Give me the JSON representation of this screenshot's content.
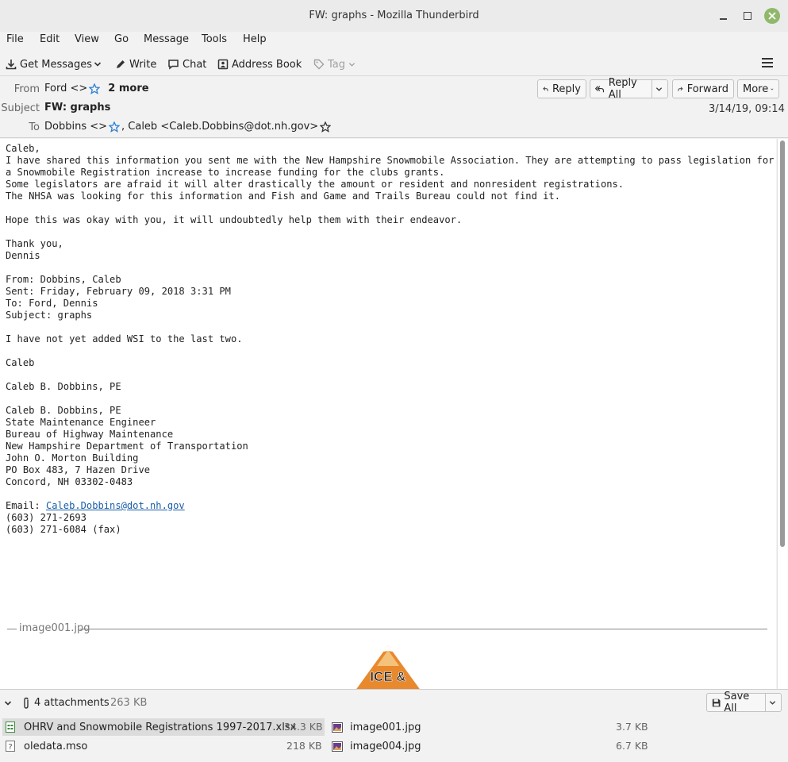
{
  "window": {
    "title": "FW: graphs - Mozilla Thunderbird"
  },
  "menu": [
    "File",
    "Edit",
    "View",
    "Go",
    "Message",
    "Tools",
    "Help"
  ],
  "toolbar": {
    "get_messages": "Get Messages",
    "write": "Write",
    "chat": "Chat",
    "address_book": "Address Book",
    "tag": "Tag"
  },
  "header": {
    "from_label": "From",
    "from_value": "Ford <>",
    "more_recipients": "2 more",
    "subject_label": "Subject",
    "subject": "FW: graphs",
    "to_label": "To",
    "to_first": "Dobbins <>",
    "to_second": ", Caleb <Caleb.Dobbins@dot.nh.gov>",
    "date": "3/14/19, 09:14",
    "buttons": {
      "reply": "Reply",
      "reply_all": "Reply All",
      "forward": "Forward",
      "more": "More"
    }
  },
  "message": {
    "lines_before_email": "Caleb,\nI have shared this information you sent me with the New Hampshire Snowmobile Association. They are attempting to pass legislation for\na Snowmobile Registration increase to increase funding for the clubs grants.\nSome legislators are afraid it will alter drastically the amount or resident and nonresident registrations.\nThe NHSA was looking for this information and Fish and Game and Trails Bureau could not find it.\n\nHope this was okay with you, it will undoubtedly help them with their endeavor.\n\nThank you,\nDennis\n\nFrom: Dobbins, Caleb\nSent: Friday, February 09, 2018 3:31 PM\nTo: Ford, Dennis\nSubject: graphs\n\nI have not yet added WSI to the last two.\n\nCaleb\n\nCaleb B. Dobbins, PE\n\nCaleb B. Dobbins, PE\nState Maintenance Engineer\nBureau of Highway Maintenance\nNew Hampshire Department of Transportation\nJohn O. Morton Building\nPO Box 483, 7 Hazen Drive\nConcord, NH 03302-0483\n\n",
    "email_prefix": "Email: ",
    "email_link": "Caleb.Dobbins@dot.nh.gov",
    "lines_after_email": "\n(603) 271-2693\n(603) 271-6084 (fax)",
    "image_label": "image001.jpg",
    "logo_text": "ICE &"
  },
  "attachments": {
    "count_label": "4 attachments",
    "total_size": "263 KB",
    "save_all": "Save All",
    "items": [
      {
        "name": "OHRV and Snowmobile Registrations 1997-2017.xlsx",
        "size": "34.3 KB"
      },
      {
        "name": "image001.jpg",
        "size": "3.7 KB"
      },
      {
        "name": "oledata.mso",
        "size": "218 KB"
      },
      {
        "name": "image004.jpg",
        "size": "6.7 KB"
      }
    ]
  },
  "colors": {
    "link": "#1a5ea8",
    "star": "#2a7fd4",
    "close_button": "#8fb86b"
  }
}
